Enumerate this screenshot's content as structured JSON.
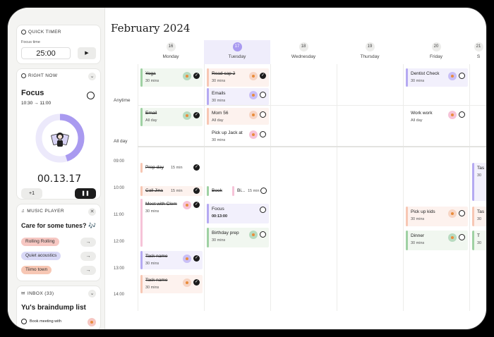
{
  "quick_timer": {
    "header": "QUICK TIMER",
    "label": "Focus time",
    "value": "25:00"
  },
  "right_now": {
    "header": "RIGHT NOW",
    "task": "Focus",
    "range": "10:30 → 11:00",
    "elapsed": "00.13.17",
    "add_label": "+1",
    "progress": 0.45
  },
  "music": {
    "header": "MUSIC PLAYER",
    "prompt": "Care for some tunes? 🎶",
    "playlists": [
      "Rolling Rolling",
      "Quiet acoustics",
      "Tiimo town"
    ],
    "colors": [
      "#f6c7c2",
      "#d8d8f6",
      "#f7c7b4"
    ]
  },
  "inbox": {
    "header": "INBOX (33)",
    "title": "Yu's braindump list",
    "first_item": "Book meeting with"
  },
  "calendar": {
    "title": "February 2024",
    "row_anytime": "Anytime",
    "row_allday": "All day",
    "days": [
      {
        "num": "16",
        "name": "Monday"
      },
      {
        "num": "17",
        "name": "Tuesday"
      },
      {
        "num": "18",
        "name": "Wednesday"
      },
      {
        "num": "19",
        "name": "Thursday"
      },
      {
        "num": "20",
        "name": "Friday"
      },
      {
        "num": "21",
        "name": "S"
      }
    ],
    "times": [
      "09:00",
      "10:00",
      "11:00",
      "12:00",
      "13:00",
      "14:00"
    ]
  },
  "events": {
    "yoga": {
      "title": "Yoga",
      "sub": "30 mins"
    },
    "read": {
      "title": "Read cap 2",
      "sub": "30 mins"
    },
    "dentist": {
      "title": "Dentist Check",
      "sub": "30 mins"
    },
    "emails": {
      "title": "Emails",
      "sub": "30 mins"
    },
    "email": {
      "title": "Email",
      "sub": "All day"
    },
    "mom": {
      "title": "Mom 56",
      "sub": "All day"
    },
    "work": {
      "title": "Work work",
      "sub": "All day"
    },
    "jack": {
      "title": "Pick up Jack at",
      "sub": "30 mins"
    },
    "prep": {
      "title": "Prep day",
      "dur": "15 min"
    },
    "jina": {
      "title": "Call Jina",
      "dur": "15 min"
    },
    "clem": {
      "title": "Meet with Clem",
      "sub": "30 mins"
    },
    "book": {
      "title": "Book"
    },
    "bi": {
      "title": "Bi...",
      "dur": "15 min"
    },
    "focus": {
      "title": "Focus",
      "sub": "00:13:00"
    },
    "bday": {
      "title": "Birthday prep",
      "sub": "30 mins"
    },
    "kids": {
      "title": "Pick up kids",
      "sub": "30 mins"
    },
    "dinner": {
      "title": "Dinner",
      "sub": "30 mins"
    },
    "task1": {
      "title": "Task name",
      "sub": "30 mins"
    },
    "task2": {
      "title": "Task name",
      "sub": "30 mins"
    },
    "edge1": {
      "title": "Tas",
      "sub": "30"
    },
    "edge2": {
      "title": "Tas",
      "sub": "30"
    },
    "edge3": {
      "title": "T",
      "sub": "30"
    }
  }
}
